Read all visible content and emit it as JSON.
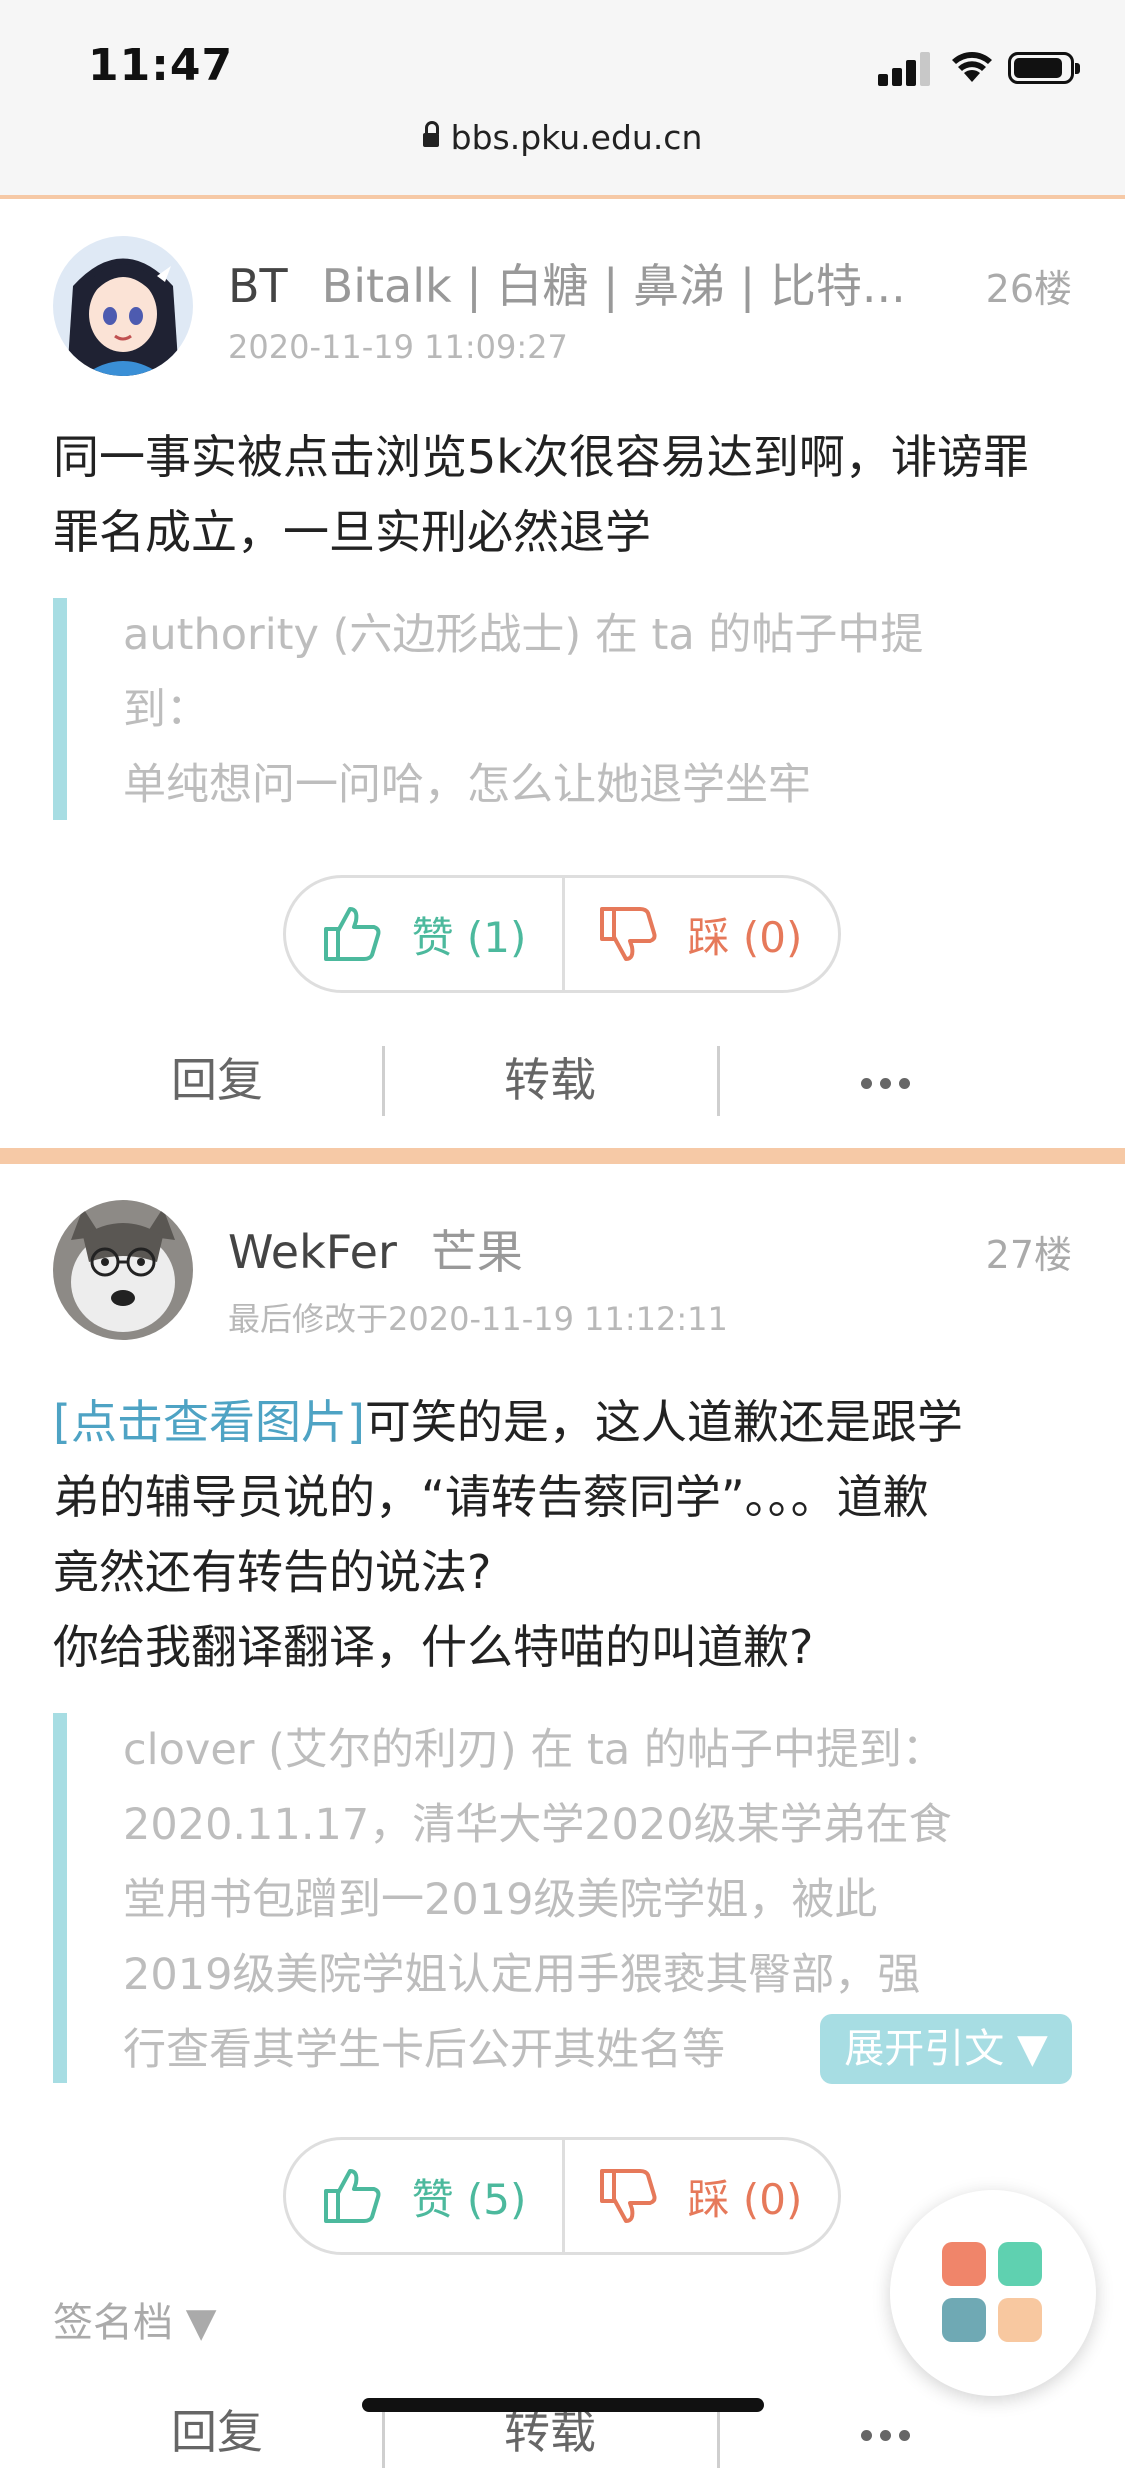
{
  "status": {
    "time": "11:47"
  },
  "browser": {
    "url": "bbs.pku.edu.cn"
  },
  "posts": [
    {
      "username": "BT",
      "nickname": "Bitalk | 白糖 | 鼻涕 | 比特...",
      "floor": "26楼",
      "timestamp": "2020-11-19 11:09:27",
      "body": "同一事实被点击浏览5k次很容易达到啊，诽谤罪罪名成立，一旦实刑必然退学",
      "quote_lines": [
        "authority (六边形战士) 在 ta 的帖子中提",
        "到：",
        "单纯想问一问哈，怎么让她退学坐牢"
      ],
      "like_label": "赞 (1)",
      "dislike_label": "踩 (0)",
      "reply_label": "回复",
      "repost_label": "转载"
    },
    {
      "username": "WekFer",
      "nickname": "芒果",
      "floor": "27楼",
      "timestamp": "最后修改于2020-11-19 11:12:11",
      "body_link": "[点击查看图片]",
      "body_lines": [
        "可笑的是，这人道歉还是跟学",
        "弟的辅导员说的，“请转告蔡同学”。。。道歉",
        "竟然还有转告的说法?",
        "你给我翻译翻译，什么特喵的叫道歉?"
      ],
      "quote_lines": [
        "clover (艾尔的利刃) 在 ta 的帖子中提到：",
        "2020.11.17，清华大学2020级某学弟在食",
        "堂用书包蹭到一2019级美院学姐，被此",
        "2019级美院学姐认定用手猥亵其臀部，强",
        "行查看其学生卡后公开其姓名等"
      ],
      "expand_label": "展开引文 ▼",
      "like_label": "赞 (5)",
      "dislike_label": "踩 (0)",
      "signature_label": "签名档 ▼",
      "reply_label": "回复",
      "repost_label": "转载"
    }
  ],
  "colors": {
    "accent_divider": "#f6c9a6",
    "quote_bar": "#a7dde3",
    "like": "#4cb99d",
    "dislike": "#e6795a"
  }
}
